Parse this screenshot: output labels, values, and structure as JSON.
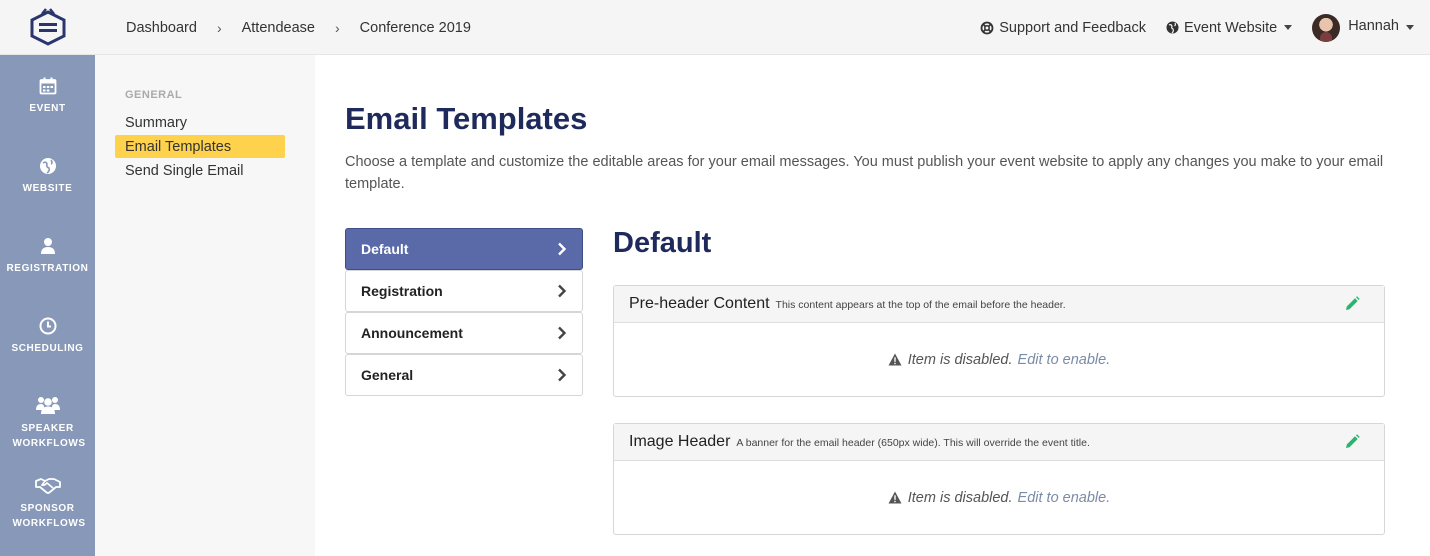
{
  "breadcrumbs": [
    "Dashboard",
    "Attendease",
    "Conference 2019"
  ],
  "top_right": {
    "support_label": "Support and Feedback",
    "event_website_label": "Event Website",
    "user_name": "Hannah"
  },
  "left_nav": [
    {
      "label": "EVENT",
      "icon": "calendar-icon"
    },
    {
      "label": "WEBSITE",
      "icon": "globe-icon"
    },
    {
      "label": "REGISTRATION",
      "icon": "user-icon"
    },
    {
      "label": "SCHEDULING",
      "icon": "clock-icon"
    },
    {
      "label": "SPEAKER WORKFLOWS",
      "icon": "users-icon"
    },
    {
      "label": "SPONSOR WORKFLOWS",
      "icon": "handshake-icon"
    }
  ],
  "sub_nav": {
    "heading": "GENERAL",
    "items": [
      "Summary",
      "Email Templates",
      "Send Single Email"
    ],
    "active_index": 1
  },
  "main": {
    "title": "Email Templates",
    "description": "Choose a template and customize the editable areas for your email messages. You must publish your event website to apply any changes you make to your email template."
  },
  "templates": {
    "items": [
      "Default",
      "Registration",
      "Announcement",
      "General"
    ],
    "active_index": 0
  },
  "section": {
    "title": "Default",
    "panels": [
      {
        "title": "Pre-header Content",
        "subtitle": "This content appears at the top of the email before the header.",
        "disabled_text": "Item is disabled.",
        "enable_link": "Edit to enable."
      },
      {
        "title": "Image Header",
        "subtitle": "A banner for the email header (650px wide). This will override the event title.",
        "disabled_text": "Item is disabled.",
        "enable_link": "Edit to enable."
      }
    ]
  },
  "colors": {
    "nav_bg": "#8898b8",
    "active_sub": "#ffd24d",
    "active_template": "#5a6aa8",
    "title": "#1f2a5c",
    "edit_icon": "#2ab56e"
  }
}
